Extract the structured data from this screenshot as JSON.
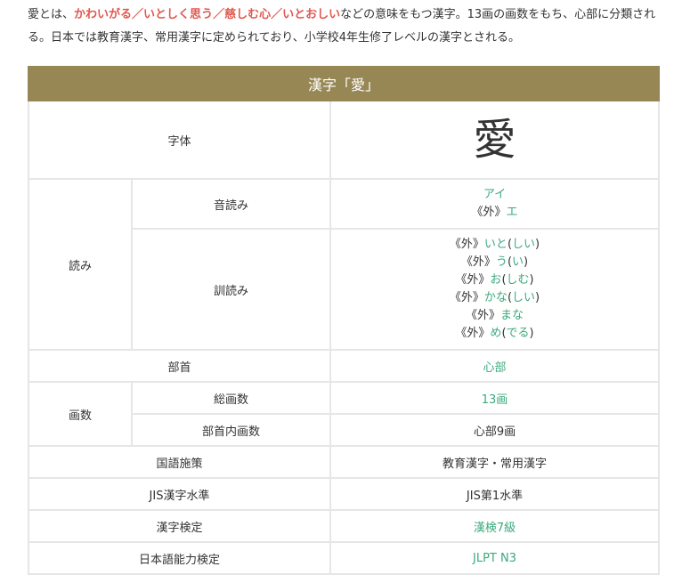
{
  "intro": {
    "t1": "愛とは、",
    "h1": "かわいがる",
    "sep1": "／",
    "h2": "いとしく思う",
    "sep2": "／",
    "h3": "慈しむ心",
    "sep3": "／",
    "h4": "いとおしい",
    "t2": "などの意味をもつ漢字。13画の画数をもち、心部に分類される。日本では教育漢字、常用漢字に定められており、小学校4年生修了レベルの漢字とされる。"
  },
  "table": {
    "caption": "漢字「愛」",
    "jitai_label": "字体",
    "jitai_value": "愛",
    "yomi_label": "読み",
    "on_label": "音読み",
    "on": [
      {
        "prefix": "",
        "reading": "アイ"
      },
      {
        "prefix": "《外》",
        "reading": "エ"
      }
    ],
    "kun_label": "訓読み",
    "kun": [
      {
        "prefix": "《外》",
        "base": "いと",
        "okuri": "しい"
      },
      {
        "prefix": "《外》",
        "base": "う",
        "okuri": "い"
      },
      {
        "prefix": "《外》",
        "base": "お",
        "okuri": "しむ"
      },
      {
        "prefix": "《外》",
        "base": "かな",
        "okuri": "しい"
      },
      {
        "prefix": "《外》",
        "base": "まな",
        "okuri": ""
      },
      {
        "prefix": "《外》",
        "base": "め",
        "okuri": "でる"
      }
    ],
    "bushu_label": "部首",
    "bushu_value": "心部",
    "kakusu_label": "画数",
    "sokakusu_label": "総画数",
    "sokakusu_value": "13画",
    "bushunai_label": "部首内画数",
    "bushunai_value": "心部9画",
    "kokugo_label": "国語施策",
    "kokugo_value": "教育漢字・常用漢字",
    "jis_label": "JIS漢字水準",
    "jis_value": "JIS第1水準",
    "kentei_label": "漢字検定",
    "kentei_value": "漢検7級",
    "jlpt_label": "日本語能力検定",
    "jlpt_value": "JLPT N3"
  },
  "colors": {
    "caption_bg": "#978754",
    "link_green": "#3aaa7c",
    "highlight_red": "#e0584f"
  }
}
